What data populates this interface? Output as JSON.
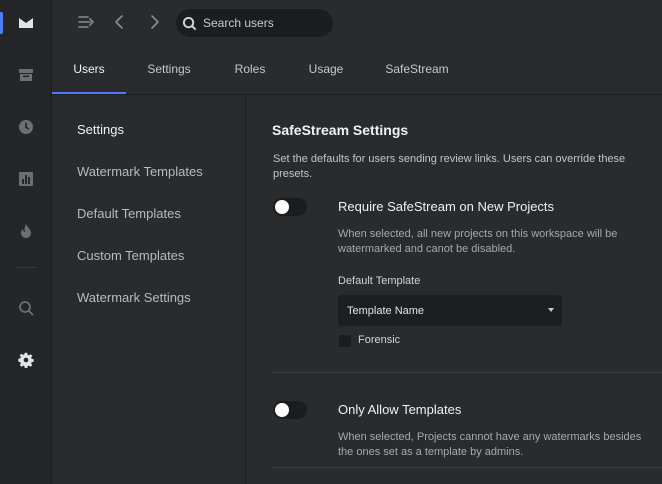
{
  "rail": {
    "items": [
      {
        "icon": "inbox-icon"
      },
      {
        "icon": "archive-icon"
      },
      {
        "icon": "clock-icon"
      },
      {
        "icon": "chart-icon"
      },
      {
        "icon": "flame-icon"
      },
      {
        "icon": "search-icon"
      },
      {
        "icon": "gear-icon"
      }
    ],
    "accent": "#4b7bff"
  },
  "topbar": {
    "search_placeholder": "Search users"
  },
  "tabs": [
    {
      "label": "Users",
      "active": true
    },
    {
      "label": "Settings",
      "active": false
    },
    {
      "label": "Roles",
      "active": false
    },
    {
      "label": "Usage",
      "active": false
    },
    {
      "label": "SafeStream",
      "active": false
    }
  ],
  "sidebar": {
    "items": [
      {
        "label": "Settings",
        "active": true
      },
      {
        "label": "Watermark Templates",
        "active": false
      },
      {
        "label": "Default Templates",
        "active": false
      },
      {
        "label": "Custom Templates",
        "active": false
      },
      {
        "label": "Watermark Settings",
        "active": false
      }
    ]
  },
  "main": {
    "title": "SafeStream Settings",
    "description": "Set the defaults for users sending review links. Users can override these presets.",
    "option1": {
      "title": "Require SafeStream on New Projects",
      "description": "When selected, all new projects on this workspace will be watermarked and canot be disabled.",
      "enabled": false
    },
    "default_template": {
      "label": "Default Template",
      "value": "Template Name"
    },
    "forensic": {
      "label": "Forensic",
      "checked": false
    },
    "option2": {
      "title": "Only Allow Templates",
      "description": "When selected, Projects cannot have any watermarks besides the ones set as a template by admins.",
      "enabled": false
    }
  }
}
